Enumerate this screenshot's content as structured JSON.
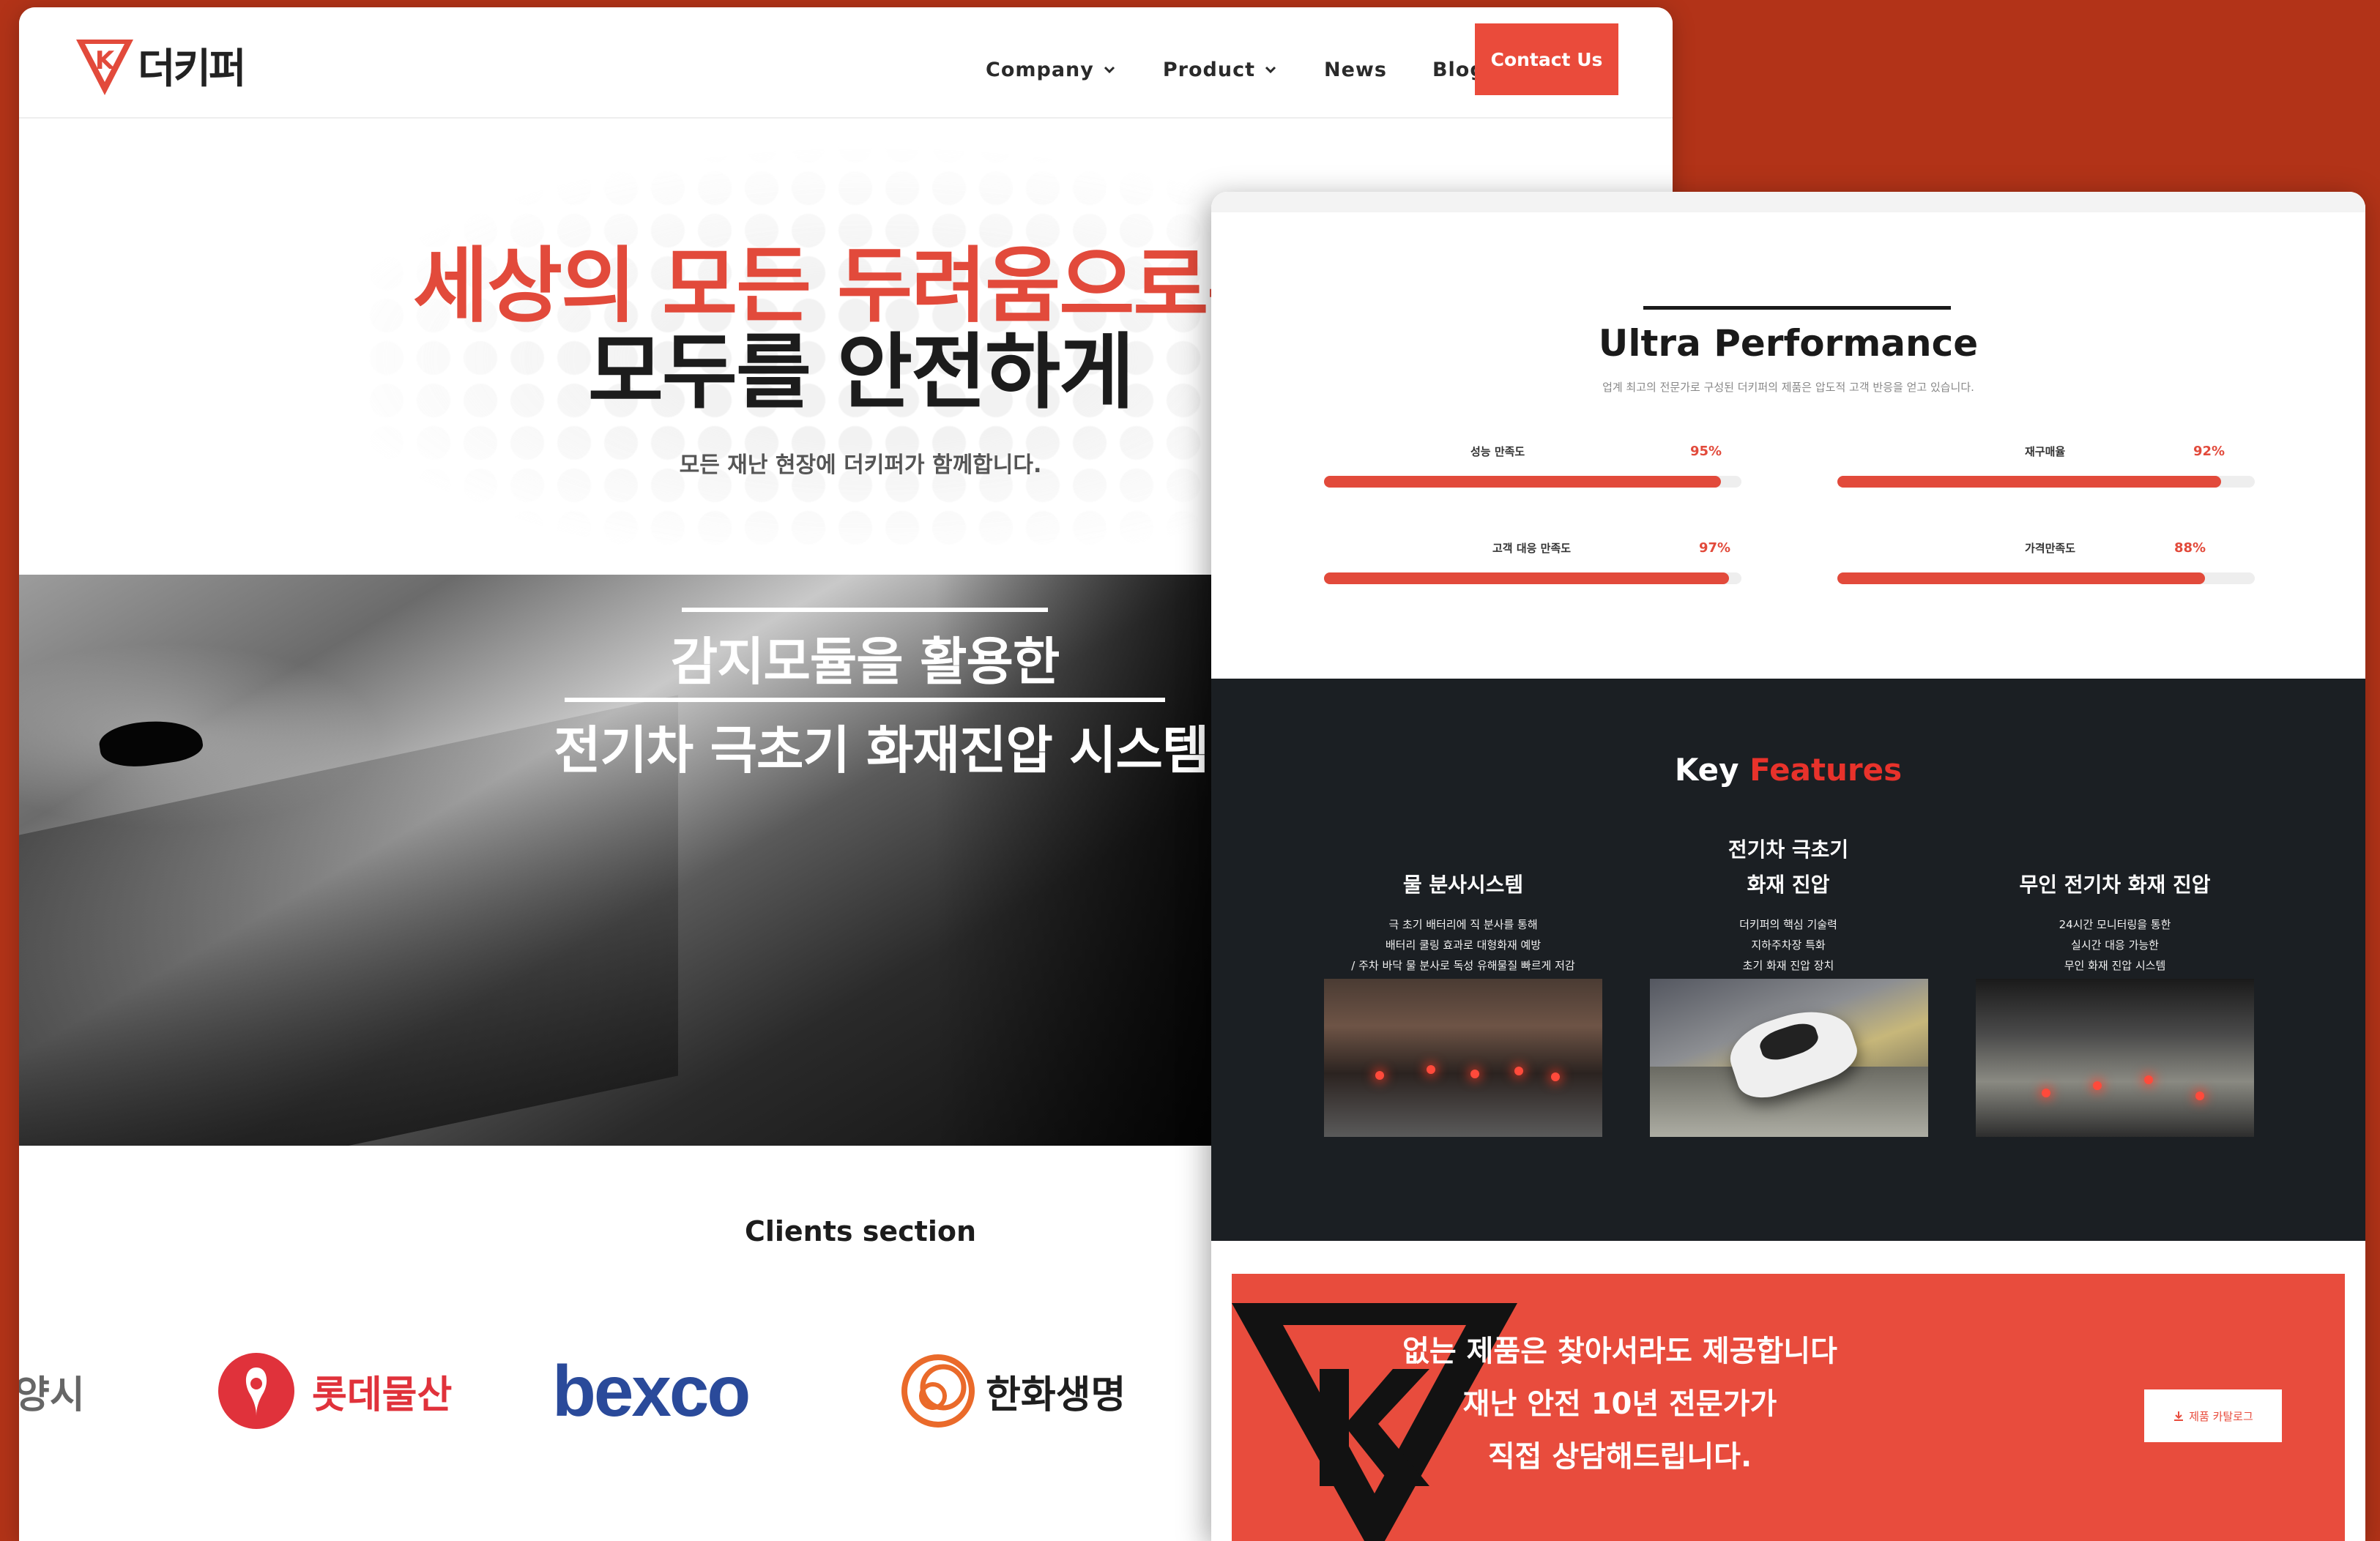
{
  "left_page": {
    "logo": {
      "mark": "K",
      "text": "더키퍼",
      "accent_color": "#e24a3b"
    },
    "nav": {
      "items": [
        {
          "label": "Company",
          "has_dropdown": true,
          "icon": "chevron-down-icon"
        },
        {
          "label": "Product",
          "has_dropdown": true,
          "icon": "chevron-down-icon"
        },
        {
          "label": "News",
          "has_dropdown": false
        },
        {
          "label": "Blog",
          "has_dropdown": false
        }
      ],
      "contact_label": "Contact Us"
    },
    "hero": {
      "line1": "세상의 모든 두려움으로부",
      "line2": "모두를 안전하게",
      "subtitle": "모든 재난 현장에 더키퍼가 함께합니다."
    },
    "banner": {
      "title_line1": "감지모듈을 활용한",
      "title_line2": "전기차 극초기 화재진압 시스템"
    },
    "clients": {
      "title": "Clients section",
      "logos": [
        {
          "name": "양시"
        },
        {
          "name": "롯데물산"
        },
        {
          "name": "bexco"
        },
        {
          "name": "한화생명"
        }
      ]
    }
  },
  "right_page": {
    "performance": {
      "title": "Ultra Performance",
      "subtitle": "업계 최고의 전문가로 구성된 더키퍼의 제품은 압도적 고객 반응을 얻고 있습니다.",
      "bars": [
        {
          "label": "성능 만족도",
          "percent_text": "95%",
          "value": 0.95
        },
        {
          "label": "재구매율",
          "percent_text": "92%",
          "value": 0.92
        },
        {
          "label": "고객 대응 만족도",
          "percent_text": "97%",
          "value": 0.97
        },
        {
          "label": "가격만족도",
          "percent_text": "88%",
          "value": 0.88
        }
      ]
    },
    "features": {
      "title_plain": "Key",
      "title_accent": "Features",
      "items": [
        {
          "title_line1": "",
          "title_line2": "물 분사시스템",
          "desc": [
            "극 초기 배터리에 직 분사를 통해",
            "배터리 쿨링 효과로 대형화재 예방",
            "/ 주차 바닥 물 분사로 독성 유해물질 빠르게 저감"
          ]
        },
        {
          "title_line1": "전기차 극초기",
          "title_line2": "화재 진압",
          "desc": [
            "더키퍼의 핵심 기술력",
            "지하주차장 특화",
            "초기 화재 진압 장치"
          ]
        },
        {
          "title_line1": "",
          "title_line2": "무인 전기차 화재 진압",
          "desc": [
            "24시간 모니터링을 통한",
            "실시간 대응 가능한",
            "무인 화재 진압 시스템"
          ]
        }
      ]
    },
    "cta": {
      "lines": [
        "없는 제품은 찾아서라도 제공합니다",
        "재난 안전 10년 전문가가",
        "직접 상담해드립니다."
      ],
      "button_label": "제품 카탈로그",
      "button_icon": "download-icon"
    }
  },
  "colors": {
    "background": "#b23318",
    "accent": "#e24a3b",
    "dark_section": "#1b1f23"
  }
}
